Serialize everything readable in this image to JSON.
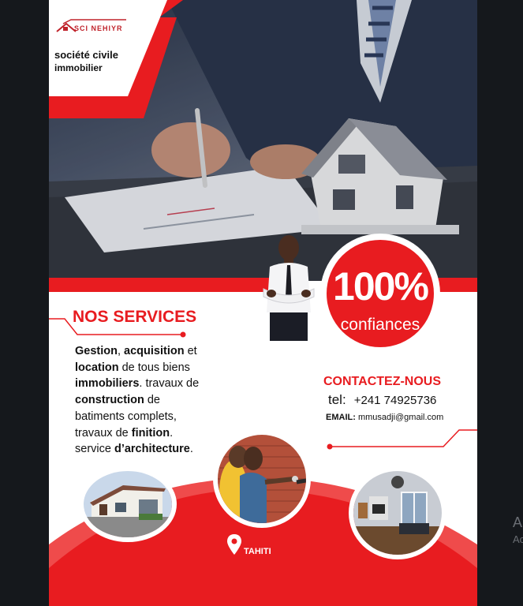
{
  "brand": {
    "logo_text": "SCI NEHIYR",
    "tagline_line1": "société civile",
    "tagline_line2": "immobilier"
  },
  "badge": {
    "big": "100%",
    "small": "confiances"
  },
  "services": {
    "title": "NOS SERVICES",
    "lines": [
      [
        {
          "t": "Gestion",
          "b": true
        },
        {
          "t": ", ",
          "b": false
        },
        {
          "t": "acquisition",
          "b": true
        },
        {
          "t": " et",
          "b": false
        }
      ],
      [
        {
          "t": "location",
          "b": true
        },
        {
          "t": " de tous biens",
          "b": false
        }
      ],
      [
        {
          "t": "immobiliers",
          "b": true
        },
        {
          "t": ". travaux de",
          "b": false
        }
      ],
      [
        {
          "t": "construction",
          "b": true
        },
        {
          "t": " de",
          "b": false
        }
      ],
      [
        {
          "t": "batiments complets,",
          "b": false
        }
      ],
      [
        {
          "t": "travaux de ",
          "b": false
        },
        {
          "t": "finition",
          "b": true
        },
        {
          "t": ".",
          "b": false
        }
      ],
      [
        {
          "t": "service ",
          "b": false
        },
        {
          "t": "d’architecture",
          "b": true
        },
        {
          "t": ".",
          "b": false
        }
      ]
    ]
  },
  "contact": {
    "title": "CONTACTEZ-NOUS",
    "tel_label": "tel:",
    "tel_value": "+241 74925736",
    "email_label": "EMAIL:",
    "email_value": "mmusadji@gmail.com"
  },
  "location": {
    "label": "TAHITI"
  },
  "side_text": {
    "line1": "A",
    "line2": "Ac"
  },
  "colors": {
    "accent_red": "#e81c20",
    "page_dark": "#15181c",
    "text_dark": "#111111"
  }
}
